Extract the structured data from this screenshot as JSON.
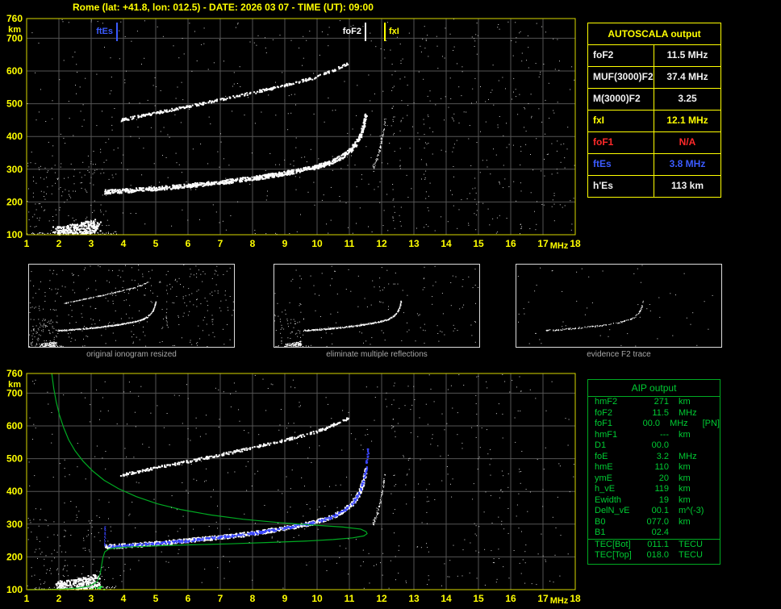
{
  "title": "Rome (lat: +41.8, lon: 012.5) - DATE: 2026 03 07 - TIME (UT): 09:00",
  "colors": {
    "axis": "#d8d800",
    "tick": "#ffff00",
    "grid": "#555555",
    "noise_dot": "#d0d0d0",
    "title": "#ffff00",
    "green_text": "#00cc33",
    "caption": "#a8a8a8"
  },
  "autoscala_table": {
    "title": "AUTOSCALA output",
    "rows": [
      {
        "label": "foF2",
        "value": "11.5 MHz",
        "color": "white"
      },
      {
        "label": "MUF(3000)F2",
        "value": "37.4 MHz",
        "color": "white"
      },
      {
        "label": "M(3000)F2",
        "value": "3.25",
        "color": "white"
      },
      {
        "label": "fxI",
        "value": "12.1 MHz",
        "color": "yellow"
      },
      {
        "label": "foF1",
        "value": "N/A",
        "color": "red"
      },
      {
        "label": "ftEs",
        "value": "3.8 MHz",
        "color": "blue"
      },
      {
        "label": "h'Es",
        "value": "113   km",
        "color": "white"
      }
    ]
  },
  "aip_table": {
    "title": "AIP output",
    "rows": [
      {
        "name": "hmF2",
        "value": "271",
        "unit": "km",
        "note": "",
        "sep": false
      },
      {
        "name": "foF2",
        "value": "11.5",
        "unit": "MHz",
        "note": "",
        "sep": false
      },
      {
        "name": "foF1",
        "value": "00.0",
        "unit": "MHz",
        "note": "[PN]",
        "sep": false
      },
      {
        "name": "hmF1",
        "value": "---",
        "unit": "km",
        "note": "",
        "sep": false
      },
      {
        "name": "D1",
        "value": "00.0",
        "unit": "",
        "note": "",
        "sep": false
      },
      {
        "name": "foE",
        "value": "3.2",
        "unit": "MHz",
        "note": "",
        "sep": false
      },
      {
        "name": "hmE",
        "value": "110",
        "unit": "km",
        "note": "",
        "sep": false
      },
      {
        "name": "ymE",
        "value": "20",
        "unit": "km",
        "note": "",
        "sep": false
      },
      {
        "name": "h_vE",
        "value": "119",
        "unit": "km",
        "note": "",
        "sep": false
      },
      {
        "name": "Ewidth",
        "value": "19",
        "unit": "km",
        "note": "",
        "sep": false
      },
      {
        "name": "DelN_vE",
        "value": "00.1",
        "unit": "m^(-3)",
        "note": "",
        "sep": false
      },
      {
        "name": "B0",
        "value": "077.0",
        "unit": "km",
        "note": "",
        "sep": false
      },
      {
        "name": "B1",
        "value": "02.4",
        "unit": "",
        "note": "",
        "sep": false
      },
      {
        "name": "TEC[Bot]",
        "value": "011.1",
        "unit": "TECU",
        "note": "",
        "sep": true
      },
      {
        "name": "TEC[Top]",
        "value": "018.0",
        "unit": "TECU",
        "note": "",
        "sep": false
      }
    ]
  },
  "thumbnails": [
    {
      "caption": "original ionogram resized"
    },
    {
      "caption": "eliminate multiple reflections"
    },
    {
      "caption": "evidence F2 trace"
    }
  ],
  "chart_data": {
    "type": "scatter",
    "x_label": "MHz",
    "y_label": "km",
    "traces": {
      "f2": {
        "color": "#ffffff",
        "size": 2,
        "count": 900,
        "jitter": [
          1.5,
          2.5
        ],
        "points": [
          [
            3.4,
            233
          ],
          [
            4,
            236
          ],
          [
            5,
            243
          ],
          [
            6,
            252
          ],
          [
            7,
            262
          ],
          [
            8,
            274
          ],
          [
            9,
            290
          ],
          [
            9.8,
            305
          ],
          [
            10.4,
            322
          ],
          [
            10.8,
            342
          ],
          [
            11.1,
            368
          ],
          [
            11.3,
            398
          ],
          [
            11.42,
            432
          ],
          [
            11.5,
            470
          ]
        ]
      },
      "f2x": {
        "color": "#ffffff",
        "size": 1,
        "count": 80,
        "jitter": [
          1,
          3
        ],
        "points": [
          [
            11.7,
            295
          ],
          [
            11.85,
            330
          ],
          [
            11.95,
            370
          ],
          [
            12.05,
            420
          ],
          [
            12.1,
            455
          ]
        ]
      },
      "second_order": {
        "color": "#ffffff",
        "size": 2,
        "count": 300,
        "jitter": [
          1,
          1.5
        ],
        "points": [
          [
            3.9,
            452
          ],
          [
            4.3,
            460
          ],
          [
            5,
            474
          ],
          [
            6,
            494
          ],
          [
            7,
            514
          ],
          [
            8,
            536
          ],
          [
            9,
            559
          ],
          [
            9.8,
            579
          ],
          [
            10.3,
            596
          ],
          [
            10.7,
            614
          ],
          [
            10.95,
            625
          ]
        ]
      },
      "es": {
        "color": "#ffffff",
        "size": 2,
        "count": 300,
        "jitter": [
          5,
          8
        ],
        "points": [
          [
            1.9,
            107
          ],
          [
            2.3,
            112
          ],
          [
            2.7,
            119
          ],
          [
            3.0,
            126
          ],
          [
            3.2,
            131
          ]
        ]
      },
      "bottom_band": {
        "color": "#ffffff",
        "size": 1,
        "count": 150,
        "jitter": [
          3,
          3
        ],
        "points": [
          [
            1.0,
            100
          ],
          [
            1.8,
            101
          ],
          [
            2.6,
            102
          ],
          [
            3.4,
            103
          ],
          [
            3.8,
            104
          ]
        ]
      },
      "blue_fit": {
        "color": "#3a46ff",
        "size": 2,
        "count": 420,
        "jitter": [
          1,
          1.5
        ],
        "points": [
          [
            3.45,
            232
          ],
          [
            4,
            236
          ],
          [
            5,
            243
          ],
          [
            6,
            252
          ],
          [
            7,
            262
          ],
          [
            8,
            274
          ],
          [
            9,
            290
          ],
          [
            9.8,
            305
          ],
          [
            10.4,
            322
          ],
          [
            10.8,
            342
          ],
          [
            11.1,
            368
          ],
          [
            11.3,
            398
          ],
          [
            11.42,
            432
          ],
          [
            11.5,
            468
          ],
          [
            11.53,
            500
          ],
          [
            11.57,
            532
          ]
        ]
      },
      "blue_start": {
        "color": "#3a46ff",
        "size": 1,
        "count": 40,
        "jitter": [
          0.8,
          1.2
        ],
        "points": [
          [
            3.42,
            232
          ],
          [
            3.42,
            298
          ]
        ]
      },
      "green_profile": {
        "color": "#00aa22",
        "line": true,
        "stroke": 1.2,
        "size": 1,
        "count": 0,
        "jitter": [
          0,
          0
        ],
        "points": [
          [
            1.78,
            760
          ],
          [
            1.84,
            715
          ],
          [
            1.92,
            672
          ],
          [
            2.02,
            632
          ],
          [
            2.15,
            594
          ],
          [
            2.3,
            558
          ],
          [
            2.5,
            524
          ],
          [
            2.75,
            492
          ],
          [
            3.05,
            462
          ],
          [
            3.4,
            434
          ],
          [
            3.85,
            408
          ],
          [
            4.4,
            384
          ],
          [
            5.05,
            362
          ],
          [
            5.8,
            344
          ],
          [
            6.7,
            328
          ],
          [
            7.7,
            315
          ],
          [
            8.8,
            305
          ],
          [
            9.9,
            297
          ],
          [
            10.8,
            291
          ],
          [
            11.35,
            285
          ],
          [
            11.52,
            277
          ],
          [
            11.55,
            271
          ],
          [
            11.45,
            264
          ],
          [
            11.1,
            258
          ],
          [
            10.5,
            253
          ],
          [
            9.6,
            248
          ],
          [
            8.5,
            244
          ],
          [
            7.3,
            240
          ],
          [
            6.1,
            237
          ],
          [
            5.1,
            234
          ],
          [
            4.3,
            231
          ],
          [
            3.8,
            228
          ],
          [
            3.55,
            224
          ],
          [
            3.42,
            215
          ],
          [
            3.36,
            196
          ],
          [
            3.32,
            172
          ],
          [
            3.28,
            148
          ],
          [
            3.18,
            124
          ],
          [
            2.95,
            111
          ],
          [
            2.6,
            105
          ],
          [
            2.15,
            102
          ],
          [
            1.6,
            100
          ],
          [
            1.05,
            100
          ]
        ]
      },
      "green_e": {
        "color": "#33ff55",
        "size": 2,
        "count": 14,
        "jitter": [
          4,
          3
        ],
        "points": [
          [
            3.05,
            101
          ],
          [
            3.3,
            106
          ]
        ]
      }
    },
    "plots": [
      {
        "id": "main",
        "seed": 7,
        "axes": true,
        "x_range": [
          1,
          18
        ],
        "y_range": [
          100,
          760
        ],
        "x_ticks": [
          1,
          2,
          3,
          4,
          5,
          6,
          7,
          8,
          9,
          10,
          11,
          12,
          13,
          14,
          15,
          16,
          17,
          18
        ],
        "y_ticks": [
          100,
          200,
          300,
          400,
          500,
          600,
          700,
          760
        ],
        "margin": {
          "l": 33,
          "t": 9,
          "r": 27,
          "b": 23
        },
        "markers": [
          {
            "label": "ftEs",
            "f": 3.8,
            "color": "#3b5bff",
            "side": "left"
          },
          {
            "label": "foF2",
            "f": 11.5,
            "color": "#ffffff",
            "side": "left"
          },
          {
            "label": "fxI",
            "f": 12.1,
            "color": "#ffff00",
            "side": "right"
          }
        ],
        "traces": [
          "f2",
          "f2x",
          "second_order",
          "es",
          "bottom_band"
        ],
        "noise": [
          {
            "count": 500,
            "x": [
              1,
              18
            ],
            "y": [
              100,
              760
            ]
          },
          {
            "count": 130,
            "x": [
              1,
              3.6
            ],
            "y": [
              100,
              330
            ]
          },
          {
            "count": 80,
            "x": [
              11.6,
              17.9
            ],
            "y": [
              110,
              750
            ]
          }
        ],
        "bands": [
          {
            "f": 12.35,
            "count": 20
          },
          {
            "f": 12.6,
            "count": 12
          },
          {
            "f": 13.4,
            "count": 16
          },
          {
            "f": 14.2,
            "count": 10
          },
          {
            "f": 14.9,
            "count": 14
          },
          {
            "f": 15.6,
            "count": 10
          },
          {
            "f": 16.3,
            "count": 12
          },
          {
            "f": 17.3,
            "count": 8
          },
          {
            "f": 4.6,
            "count": 6
          },
          {
            "f": 9.3,
            "count": 6
          }
        ]
      },
      {
        "id": "profile",
        "seed": 11,
        "axes": true,
        "x_range": [
          1,
          18
        ],
        "y_range": [
          100,
          760
        ],
        "x_ticks": [
          1,
          2,
          3,
          4,
          5,
          6,
          7,
          8,
          9,
          10,
          11,
          12,
          13,
          14,
          15,
          16,
          17,
          18
        ],
        "y_ticks": [
          100,
          200,
          300,
          400,
          500,
          600,
          700,
          760
        ],
        "margin": {
          "l": 33,
          "t": 8,
          "r": 27,
          "b": 24
        },
        "markers": [],
        "traces": [
          "f2",
          "f2x",
          "second_order",
          "es",
          "bottom_band",
          "blue_start",
          "blue_fit",
          "green_e",
          "green_profile"
        ],
        "noise": [
          {
            "count": 430,
            "x": [
              1,
              18
            ],
            "y": [
              100,
              760
            ]
          },
          {
            "count": 110,
            "x": [
              1,
              3.6
            ],
            "y": [
              100,
              330
            ]
          },
          {
            "count": 60,
            "x": [
              11.6,
              17.9
            ],
            "y": [
              110,
              750
            ]
          }
        ],
        "bands": [
          {
            "f": 12.35,
            "count": 14
          },
          {
            "f": 13.4,
            "count": 10
          },
          {
            "f": 14.9,
            "count": 10
          },
          {
            "f": 16.3,
            "count": 8
          }
        ]
      },
      {
        "id": "thumb1",
        "seed": 21,
        "axes": false,
        "dot": 1,
        "scale": 0.5,
        "x_range": [
          1,
          18
        ],
        "y_range": [
          100,
          760
        ],
        "x_ticks": [],
        "y_ticks": [],
        "margin": {
          "l": 0,
          "t": 0,
          "r": 0,
          "b": 0
        },
        "markers": [],
        "traces": [
          "f2",
          "second_order",
          "es",
          "bottom_band"
        ],
        "noise": [
          {
            "count": 300,
            "x": [
              1,
              18
            ],
            "y": [
              100,
              760
            ]
          },
          {
            "count": 80,
            "x": [
              1,
              3.6
            ],
            "y": [
              100,
              330
            ]
          }
        ],
        "bands": [
          {
            "f": 12.4,
            "count": 10
          },
          {
            "f": 14.9,
            "count": 8
          },
          {
            "f": 16.2,
            "count": 8
          }
        ]
      },
      {
        "id": "thumb2",
        "seed": 22,
        "axes": false,
        "dot": 1,
        "scale": 0.5,
        "x_range": [
          1,
          18
        ],
        "y_range": [
          100,
          760
        ],
        "x_ticks": [],
        "y_ticks": [],
        "margin": {
          "l": 0,
          "t": 0,
          "r": 0,
          "b": 0
        },
        "markers": [],
        "traces": [
          "f2",
          "es",
          "bottom_band"
        ],
        "noise": [
          {
            "count": 140,
            "x": [
              1,
              18
            ],
            "y": [
              100,
              760
            ]
          },
          {
            "count": 40,
            "x": [
              1,
              3.6
            ],
            "y": [
              100,
              330
            ]
          }
        ],
        "bands": [
          {
            "f": 13.4,
            "count": 6
          }
        ]
      },
      {
        "id": "thumb3",
        "seed": 23,
        "axes": false,
        "dot": 1,
        "scale": 0.18,
        "x_range": [
          1,
          18
        ],
        "y_range": [
          100,
          760
        ],
        "x_ticks": [],
        "y_ticks": [],
        "margin": {
          "l": 0,
          "t": 0,
          "r": 0,
          "b": 0
        },
        "markers": [],
        "traces": [
          "f2"
        ],
        "noise": [
          {
            "count": 60,
            "x": [
              1,
              18
            ],
            "y": [
              100,
              760
            ]
          }
        ],
        "bands": []
      }
    ]
  }
}
